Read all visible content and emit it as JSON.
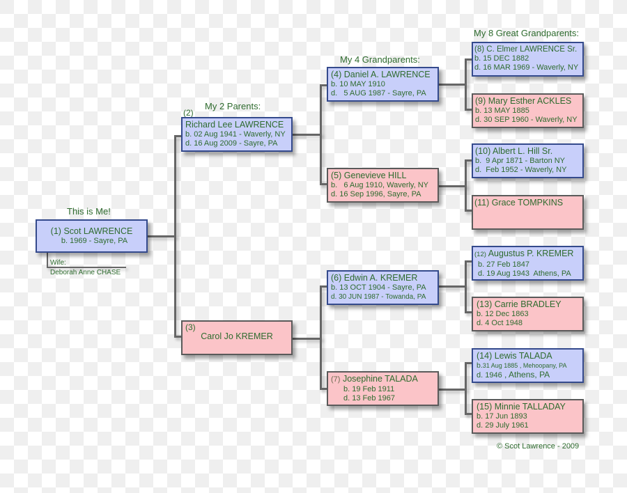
{
  "headings": {
    "me": "This is Me!",
    "parents": "My 2 Parents:",
    "grandparents": "My 4 Grandparents:",
    "great_grandparents": "My 8 Great Grandparents:"
  },
  "people": {
    "p1": {
      "num": "(1)",
      "name": "Scot LAWRENCE",
      "birth": "b. 1969 - Sayre, PA",
      "gender": "male"
    },
    "p2": {
      "num": "(2)",
      "name": "Richard Lee LAWRENCE",
      "birth": "b. 02 Aug 1941 - Waverly, NY",
      "death": "d. 16 Aug 2009 - Sayre, PA",
      "gender": "male"
    },
    "p3": {
      "num": "(3)",
      "name": "Carol Jo KREMER",
      "gender": "female"
    },
    "p4": {
      "num": "(4)",
      "name": "Daniel A. LAWRENCE",
      "birth": "b. 10 MAY 1910",
      "death": "d.   5 AUG 1987 - Sayre, PA",
      "gender": "male"
    },
    "p5": {
      "num": "(5)",
      "name": "Genevieve HILL",
      "birth": "b.   6 Aug 1910, Waverly, NY",
      "death": "d. 16 Sep 1996, Sayre, PA",
      "gender": "female"
    },
    "p6": {
      "num": "(6)",
      "name": "Edwin A. KREMER",
      "birth": "b. 13 OCT 1904 - Sayre, PA",
      "death": "d. 30 JUN 1987 - Towanda, PA",
      "gender": "male"
    },
    "p7": {
      "num": "(7)",
      "name": "Josephine TALADA",
      "birth": "b. 19 Feb 1911",
      "death": "d. 13 Feb 1967",
      "gender": "female"
    },
    "p8": {
      "num": "(8)",
      "name": "C. Elmer LAWRENCE Sr.",
      "birth": "b. 15 DEC 1882",
      "death": "d. 16 MAR 1969 - Waverly, NY",
      "gender": "male"
    },
    "p9": {
      "num": "(9)",
      "name": "Mary Esther ACKLES",
      "birth": "b. 13 MAY 1885",
      "death": "d. 30 SEP 1960 - Waverly, NY",
      "gender": "female"
    },
    "p10": {
      "num": "(10)",
      "name": "Albert L. Hill Sr.",
      "birth": "b.  9 Apr 1871 - Barton NY",
      "death": "d.  Feb 1952 - Waverly, NY",
      "gender": "male"
    },
    "p11": {
      "num": "(11)",
      "name": "Grace TOMPKINS",
      "gender": "female"
    },
    "p12": {
      "num": "(12)",
      "name": "Augustus P. KREMER",
      "birth": "b. 27 Feb 1847",
      "death": "d. 19 Aug 1943  Athens, PA",
      "gender": "male"
    },
    "p13": {
      "num": "(13)",
      "name": "Carrie BRADLEY",
      "birth": "b. 12 Dec 1863",
      "death": "d. 4 Oct 1948",
      "gender": "female"
    },
    "p14": {
      "num": "(14)",
      "name": "Lewis TALADA",
      "birth_prefix": "b.",
      "birth": "31 Aug 1885 , Mehoopany, PA",
      "death_prefix": "d. 1946",
      "death": " , Athens, PA",
      "gender": "male"
    },
    "p15": {
      "num": "(15)",
      "name": "Minnie TALLADAY",
      "birth": "b. 17 Jun 1893",
      "death": "d. 29 July 1961",
      "gender": "female"
    }
  },
  "spouse": {
    "label": "Wife:",
    "name": "Deborah Anne CHASE"
  },
  "copyright": "© Scot Lawrence - 2009",
  "colors": {
    "male_fill": "#c8cffa",
    "male_border": "#344a8c",
    "female_fill": "#fbc4c8",
    "female_border": "#5a5a5a",
    "text": "#2e6b2e",
    "connector": "#666666"
  }
}
